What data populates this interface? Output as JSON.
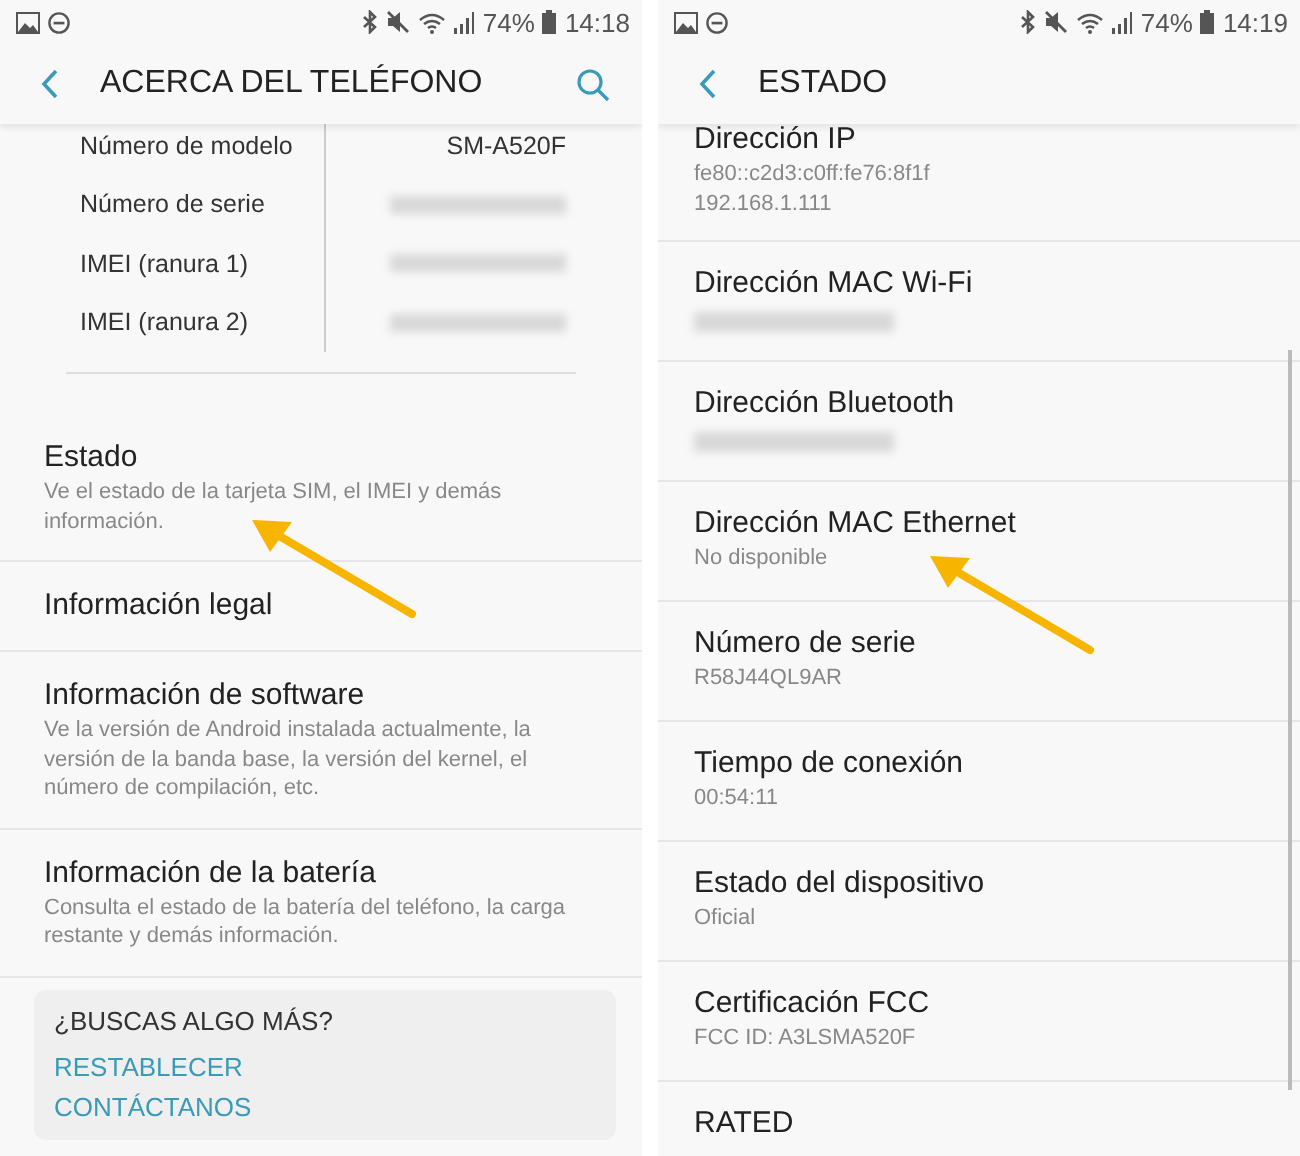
{
  "screens": [
    {
      "status_bar": {
        "battery": "74%",
        "time": "14:18"
      },
      "header": {
        "title": "ACERCA DEL TELÉFONO",
        "search_button": true
      },
      "spec_table": [
        {
          "label": "Número de modelo",
          "value": "SM-A520F",
          "redacted": false
        },
        {
          "label": "Número de serie",
          "redacted": true
        },
        {
          "label": "IMEI (ranura 1)",
          "redacted": true
        },
        {
          "label": "IMEI (ranura 2)",
          "redacted": true
        }
      ],
      "items": [
        {
          "title": "Estado",
          "subtitle": "Ve el estado de la tarjeta SIM, el IMEI y demás información.",
          "redacted": false,
          "highlighted": true
        },
        {
          "title": "Información legal",
          "redacted": false,
          "highlighted": false
        },
        {
          "title": "Información de software",
          "subtitle": "Ve la versión de Android instalada actualmente, la versión de la banda base, la versión del kernel, el número de compilación, etc.",
          "redacted": false,
          "highlighted": false
        },
        {
          "title": "Información de la batería",
          "subtitle": "Consulta el estado de la batería del teléfono, la carga restante y demás información.",
          "redacted": false,
          "highlighted": false
        }
      ],
      "help_card": {
        "title": "¿BUSCAS ALGO MÁS?",
        "links": [
          "RESTABLECER",
          "CONTÁCTANOS"
        ]
      }
    },
    {
      "status_bar": {
        "battery": "74%",
        "time": "14:19"
      },
      "header": {
        "title": "ESTADO",
        "search_button": false
      },
      "scrollbar": true,
      "items": [
        {
          "title": "Dirección IP",
          "subtitle": "fe80::c2d3:c0ff:fe76:8f1f\n192.168.1.111",
          "redacted": false,
          "highlighted": false
        },
        {
          "title": "Dirección MAC Wi-Fi",
          "redacted": true,
          "highlighted": false
        },
        {
          "title": "Dirección Bluetooth",
          "redacted": true,
          "highlighted": false
        },
        {
          "title": "Dirección MAC Ethernet",
          "subtitle": "No disponible",
          "redacted": false,
          "highlighted": true
        },
        {
          "title": "Número de serie",
          "subtitle": "R58J44QL9AR",
          "redacted": false,
          "highlighted": false
        },
        {
          "title": "Tiempo de conexión",
          "subtitle": "00:54:11",
          "redacted": false,
          "highlighted": false
        },
        {
          "title": "Estado del dispositivo",
          "subtitle": "Oficial",
          "redacted": false,
          "highlighted": false
        },
        {
          "title": "Certificación FCC",
          "subtitle": "FCC ID: A3LSMA520F",
          "redacted": false,
          "highlighted": false
        },
        {
          "title": "RATED",
          "redacted": false,
          "highlighted": false
        }
      ]
    }
  ]
}
